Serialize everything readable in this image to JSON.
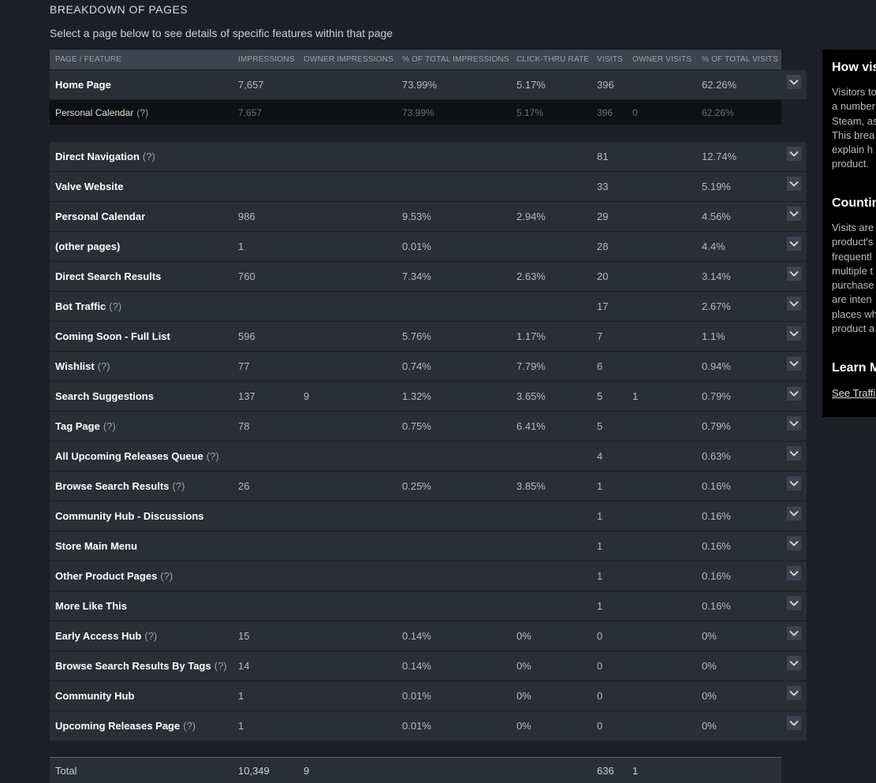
{
  "section": {
    "title": "BREAKDOWN OF PAGES",
    "subtitle": "Select a page below to see details of specific features within that page"
  },
  "table": {
    "headers": [
      "PAGE / FEATURE",
      "IMPRESSIONS",
      "OWNER IMPRESSIONS",
      "% OF TOTAL IMPRESSIONS",
      "CLICK-THRU RATE",
      "VISITS",
      "OWNER VISITS",
      "% OF TOTAL VISITS"
    ],
    "home": {
      "name": "Home Page",
      "impressions": "7,657",
      "owner_impressions": "",
      "pct_impressions": "73.99%",
      "ctr": "5.17%",
      "visits": "396",
      "owner_visits": "",
      "pct_visits": "62.26%"
    },
    "home_sub": {
      "name": "Personal Calendar",
      "help": "(?)",
      "impressions": "7,657",
      "owner_impressions": "",
      "pct_impressions": "73.99%",
      "ctr": "5.17%",
      "visits": "396",
      "owner_visits": "0",
      "pct_visits": "62.26%"
    },
    "rows": [
      {
        "name": "Direct Navigation",
        "help": "(?)",
        "impressions": "",
        "owner_impressions": "",
        "pct_impressions": "",
        "ctr": "",
        "visits": "81",
        "owner_visits": "",
        "pct_visits": "12.74%"
      },
      {
        "name": "Valve Website",
        "help": "",
        "impressions": "",
        "owner_impressions": "",
        "pct_impressions": "",
        "ctr": "",
        "visits": "33",
        "owner_visits": "",
        "pct_visits": "5.19%"
      },
      {
        "name": "Personal Calendar",
        "help": "",
        "impressions": "986",
        "owner_impressions": "",
        "pct_impressions": "9.53%",
        "ctr": "2.94%",
        "visits": "29",
        "owner_visits": "",
        "pct_visits": "4.56%"
      },
      {
        "name": "(other pages)",
        "help": "",
        "impressions": "1",
        "owner_impressions": "",
        "pct_impressions": "0.01%",
        "ctr": "",
        "visits": "28",
        "owner_visits": "",
        "pct_visits": "4.4%"
      },
      {
        "name": "Direct Search Results",
        "help": "",
        "impressions": "760",
        "owner_impressions": "",
        "pct_impressions": "7.34%",
        "ctr": "2.63%",
        "visits": "20",
        "owner_visits": "",
        "pct_visits": "3.14%"
      },
      {
        "name": "Bot Traffic",
        "help": "(?)",
        "impressions": "",
        "owner_impressions": "",
        "pct_impressions": "",
        "ctr": "",
        "visits": "17",
        "owner_visits": "",
        "pct_visits": "2.67%"
      },
      {
        "name": "Coming Soon - Full List",
        "help": "",
        "impressions": "596",
        "owner_impressions": "",
        "pct_impressions": "5.76%",
        "ctr": "1.17%",
        "visits": "7",
        "owner_visits": "",
        "pct_visits": "1.1%"
      },
      {
        "name": "Wishlist",
        "help": "(?)",
        "impressions": "77",
        "owner_impressions": "",
        "pct_impressions": "0.74%",
        "ctr": "7.79%",
        "visits": "6",
        "owner_visits": "",
        "pct_visits": "0.94%"
      },
      {
        "name": "Search Suggestions",
        "help": "",
        "impressions": "137",
        "owner_impressions": "9",
        "pct_impressions": "1.32%",
        "ctr": "3.65%",
        "visits": "5",
        "owner_visits": "1",
        "pct_visits": "0.79%"
      },
      {
        "name": "Tag Page",
        "help": "(?)",
        "impressions": "78",
        "owner_impressions": "",
        "pct_impressions": "0.75%",
        "ctr": "6.41%",
        "visits": "5",
        "owner_visits": "",
        "pct_visits": "0.79%"
      },
      {
        "name": "All Upcoming Releases Queue",
        "help": "(?)",
        "impressions": "",
        "owner_impressions": "",
        "pct_impressions": "",
        "ctr": "",
        "visits": "4",
        "owner_visits": "",
        "pct_visits": "0.63%"
      },
      {
        "name": "Browse Search Results",
        "help": "(?)",
        "impressions": "26",
        "owner_impressions": "",
        "pct_impressions": "0.25%",
        "ctr": "3.85%",
        "visits": "1",
        "owner_visits": "",
        "pct_visits": "0.16%"
      },
      {
        "name": "Community Hub - Discussions",
        "help": "",
        "impressions": "",
        "owner_impressions": "",
        "pct_impressions": "",
        "ctr": "",
        "visits": "1",
        "owner_visits": "",
        "pct_visits": "0.16%"
      },
      {
        "name": "Store Main Menu",
        "help": "",
        "impressions": "",
        "owner_impressions": "",
        "pct_impressions": "",
        "ctr": "",
        "visits": "1",
        "owner_visits": "",
        "pct_visits": "0.16%"
      },
      {
        "name": "Other Product Pages",
        "help": "(?)",
        "impressions": "",
        "owner_impressions": "",
        "pct_impressions": "",
        "ctr": "",
        "visits": "1",
        "owner_visits": "",
        "pct_visits": "0.16%"
      },
      {
        "name": "More Like This",
        "help": "",
        "impressions": "",
        "owner_impressions": "",
        "pct_impressions": "",
        "ctr": "",
        "visits": "1",
        "owner_visits": "",
        "pct_visits": "0.16%"
      },
      {
        "name": "Early Access Hub",
        "help": "(?)",
        "impressions": "15",
        "owner_impressions": "",
        "pct_impressions": "0.14%",
        "ctr": "0%",
        "visits": "0",
        "owner_visits": "",
        "pct_visits": "0%"
      },
      {
        "name": "Browse Search Results By Tags",
        "help": "(?)",
        "impressions": "14",
        "owner_impressions": "",
        "pct_impressions": "0.14%",
        "ctr": "0%",
        "visits": "0",
        "owner_visits": "",
        "pct_visits": "0%"
      },
      {
        "name": "Community Hub",
        "help": "",
        "impressions": "1",
        "owner_impressions": "",
        "pct_impressions": "0.01%",
        "ctr": "0%",
        "visits": "0",
        "owner_visits": "",
        "pct_visits": "0%"
      },
      {
        "name": "Upcoming Releases Page",
        "help": "(?)",
        "impressions": "1",
        "owner_impressions": "",
        "pct_impressions": "0.01%",
        "ctr": "0%",
        "visits": "0",
        "owner_visits": "",
        "pct_visits": "0%"
      }
    ],
    "total": {
      "name": "Total",
      "impressions": "10,349",
      "owner_impressions": "9",
      "pct_impressions": "",
      "ctr": "",
      "visits": "636",
      "owner_visits": "1",
      "pct_visits": ""
    }
  },
  "side_panel": {
    "heading1": "How vis",
    "para1": [
      "Visitors to",
      "a number",
      "Steam, as",
      "This brea",
      "explain h",
      "product."
    ],
    "heading2": "Countin",
    "para2": [
      "Visits are",
      "product's",
      "frequentl",
      "multiple t",
      "purchase",
      "are inten",
      "places wh",
      "product a"
    ],
    "heading3": "Learn M",
    "link": "See Traffi"
  },
  "colors": {
    "background": "#1c1f25",
    "row_bg": "#2a2e35",
    "header_bg": "#3d4450",
    "sub_row_bg": "#0e1012",
    "panel_bg": "#000000"
  },
  "icons": {
    "toggle": "chevron-down-icon"
  }
}
